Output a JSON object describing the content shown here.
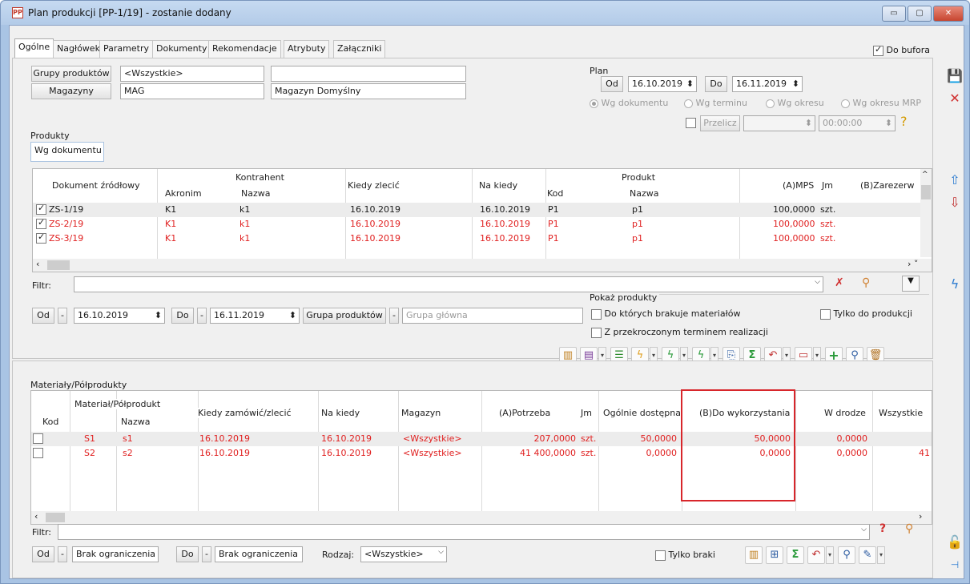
{
  "window": {
    "title": "Plan produkcji [PP-1/19] - zostanie dodany",
    "icon": "PP",
    "minimize": "▭",
    "maximize": "▢",
    "close": "✕"
  },
  "tabs": [
    "Ogólne",
    "Nagłówek",
    "Parametry",
    "Dokumenty",
    "Rekomendacje",
    "Atrybuty",
    "Załączniki"
  ],
  "do_bufora": "Do bufora",
  "grupy_label": "Grupy produktów",
  "grupy_value": "<Wszystkie>",
  "magazyny_label": "Magazyny",
  "magazyny_code": "MAG",
  "magazyny_name": "Magazyn Domyślny",
  "plan": {
    "label": "Plan",
    "od": "Od",
    "od_date": "16.10.2019",
    "do": "Do",
    "do_date": "16.11.2019",
    "radios": [
      "Wg dokumentu",
      "Wg terminu",
      "Wg okresu",
      "Wg okresu MRP"
    ],
    "przelicz": "Przelicz",
    "time": "00:00:00"
  },
  "produkty": {
    "label": "Produkty",
    "subtab": "Wg dokumentu",
    "headers": {
      "dokument": "Dokument źródłowy",
      "kontrahent": "Kontrahent",
      "akronim": "Akronim",
      "nazwa": "Nazwa",
      "kiedy": "Kiedy zlecić",
      "na_kiedy": "Na kiedy",
      "produkt": "Produkt",
      "kod": "Kod",
      "pnazwa": "Nazwa",
      "mps": "(A)MPS",
      "jm": "Jm",
      "zarez": "(B)Zarezerw"
    },
    "rows": [
      {
        "dok": "ZS-1/19",
        "akr": "K1",
        "naz": "k1",
        "kiedy": "16.10.2019",
        "na": "16.10.2019",
        "kod": "P1",
        "pnaz": "p1",
        "mps": "100,0000",
        "jm": "szt.",
        "red": false
      },
      {
        "dok": "ZS-2/19",
        "akr": "K1",
        "naz": "k1",
        "kiedy": "16.10.2019",
        "na": "16.10.2019",
        "kod": "P1",
        "pnaz": "p1",
        "mps": "100,0000",
        "jm": "szt.",
        "red": true
      },
      {
        "dok": "ZS-3/19",
        "akr": "K1",
        "naz": "k1",
        "kiedy": "16.10.2019",
        "na": "16.10.2019",
        "kod": "P1",
        "pnaz": "p1",
        "mps": "100,0000",
        "jm": "szt.",
        "red": true
      }
    ]
  },
  "filtr": "Filtr:",
  "od_label": "Od",
  "od_date2": "16.10.2019",
  "do_label": "Do",
  "do_date2": "16.11.2019",
  "grupa_btn": "Grupa produktów",
  "grupa_placeholder": "Grupa główna",
  "pokaz": {
    "label": "Pokaż produkty",
    "opt1": "Do których brakuje materiałów",
    "opt2": "Z przekroczonym terminem realizacji",
    "opt3": "Tylko do produkcji"
  },
  "materialy": {
    "label": "Materiały/Półprodukty",
    "headers": {
      "kod": "Kod",
      "mat": "Materiał/Półprodukt",
      "nazwa": "Nazwa",
      "kiedy": "Kiedy zamówić/zlecić",
      "na_kiedy": "Na kiedy",
      "magazyn": "Magazyn",
      "potrzeba": "(A)Potrzeba",
      "jm": "Jm",
      "ogolnie": "Ogólnie dostępna",
      "dowyk": "(B)Do wykorzystania",
      "wdrodze": "W drodze",
      "wszystkie": "Wszystkie"
    },
    "rows": [
      {
        "kod": "S1",
        "naz": "s1",
        "kiedy": "16.10.2019",
        "na": "16.10.2019",
        "mag": "<Wszystkie>",
        "pot": "207,0000",
        "jm": "szt.",
        "og": "50,0000",
        "dw": "50,0000",
        "wd": "0,0000",
        "ws": ""
      },
      {
        "kod": "S2",
        "naz": "s2",
        "kiedy": "16.10.2019",
        "na": "16.10.2019",
        "mag": "<Wszystkie>",
        "pot": "41 400,0000",
        "jm": "szt.",
        "og": "0,0000",
        "dw": "0,0000",
        "wd": "0,0000",
        "ws": "41"
      }
    ]
  },
  "filtr2": "Filtr:",
  "bottom": {
    "od": "Od",
    "od_val": "Brak ograniczenia",
    "do": "Do",
    "do_val": "Brak ograniczenia",
    "rodzaj": "Rodzaj:",
    "rodzaj_val": "<Wszystkie>",
    "tylko_braki": "Tylko braki"
  }
}
